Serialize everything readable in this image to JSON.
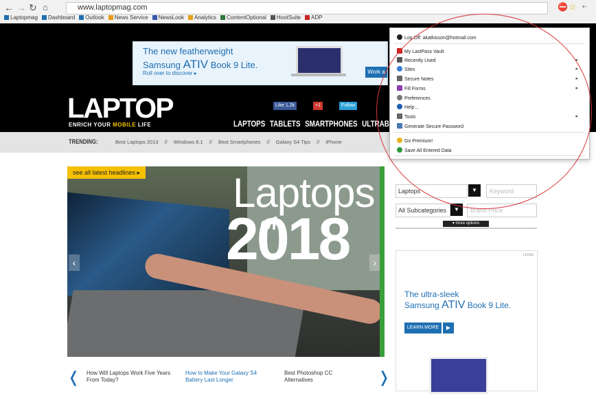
{
  "browser": {
    "url": "www.laptopmag.com",
    "bookmarks": [
      {
        "label": "Laptopmag",
        "color": "#1e6fb2"
      },
      {
        "label": "Dashboard",
        "color": "#1e6fb2"
      },
      {
        "label": "Outlook",
        "color": "#1e6fb2"
      },
      {
        "label": "News Service",
        "color": "#e89a1a"
      },
      {
        "label": "NewsLook",
        "color": "#3355aa"
      },
      {
        "label": "Analytics",
        "color": "#e8a21a"
      },
      {
        "label": "ContentOptional",
        "color": "#2b7a3a"
      },
      {
        "label": "HootSuite",
        "color": "#555"
      },
      {
        "label": "ADP",
        "color": "#cc2222"
      }
    ]
  },
  "ad_top": {
    "line1": "The new featherweight",
    "line2_prefix": "Samsung ",
    "line2_brand": "ATIV",
    "line2_suffix": " Book 9 Lite.",
    "cta": "Roll over to discover ▸",
    "button": "Work a"
  },
  "site": {
    "logo": "LAPTOP",
    "tagline_prefix": "ENRICH YOUR ",
    "tagline_highlight": "MOBILE",
    "tagline_suffix": " LIFE",
    "social": [
      {
        "label": "Like",
        "count": "1.2k",
        "color": "#3b5998"
      },
      {
        "label": "+1",
        "count": "",
        "color": "#cc3732"
      },
      {
        "label": "Follow",
        "count": "",
        "color": "#2a9fd8"
      }
    ],
    "nav": [
      "LAPTOPS",
      "TABLETS",
      "SMARTPHONES",
      "ULTRABOOKS"
    ],
    "trending_label": "TRENDING:",
    "trending": [
      "Best Laptops 2013",
      "//",
      "Windows 8.1",
      "//",
      "Best Smartphones",
      "//",
      "Galaxy S4 Tips",
      "//",
      "iPhone"
    ]
  },
  "hero": {
    "latest_link": "see all latest headlines ▸",
    "title_word": "Laptops",
    "of_word": "of",
    "year": "2018",
    "prev": "‹",
    "next": "›"
  },
  "headlines": [
    {
      "text": "How Will Laptops Work Five Years From Today?",
      "active": false
    },
    {
      "text": "How to Make Your Galaxy S4 Battery Last Longer",
      "active": true
    },
    {
      "text": "Best Photoshop CC Alternatives",
      "active": false
    }
  ],
  "search": {
    "category": "Laptops",
    "keyword_placeholder": "Keyword",
    "subcategory": "All Subcategories",
    "brand_placeholder": "Brand Price",
    "more_options": "▾ more options"
  },
  "ad_right": {
    "legal": "LEGAL",
    "line1": "The ultra-sleek",
    "line2_prefix": "Samsung ",
    "line2_brand": "ATIV",
    "line2_suffix": " Book 9 Lite.",
    "learn_more": "LEARN MORE",
    "play": "▶"
  },
  "lastpass_menu": {
    "items": [
      {
        "label": "Log Off: akatkisson@hotmail.com",
        "icon": "power-icon",
        "color": "#222",
        "submenu": false
      },
      {
        "label": "My LastPass Vault",
        "icon": "vault-icon",
        "color": "#cc2222",
        "submenu": false
      },
      {
        "label": "Recently Used",
        "icon": "clock-icon",
        "color": "#555",
        "submenu": true
      },
      {
        "label": "Sites",
        "icon": "globe-icon",
        "color": "#3b7fd0",
        "submenu": true
      },
      {
        "label": "Secure Notes",
        "icon": "note-icon",
        "color": "#666",
        "submenu": true
      },
      {
        "label": "Fill Forms",
        "icon": "form-icon",
        "color": "#8a3fb0",
        "submenu": true
      },
      {
        "label": "Preferences",
        "icon": "gear-icon",
        "color": "#777",
        "submenu": false
      },
      {
        "label": "Help...",
        "icon": "help-icon",
        "color": "#1e5fb0",
        "submenu": false
      },
      {
        "label": "Tools",
        "icon": "tools-icon",
        "color": "#666",
        "submenu": true
      },
      {
        "label": "Generate Secure Password",
        "icon": "password-icon",
        "color": "#4a7ab0",
        "submenu": false
      },
      {
        "label": "Go Premium!",
        "icon": "star-icon",
        "color": "#e8b21a",
        "submenu": false
      },
      {
        "label": "Save All Entered Data",
        "icon": "plus-icon",
        "color": "#2a9a3a",
        "submenu": false
      }
    ]
  },
  "colors": {
    "accent": "#1e6fb2",
    "highlight": "#f5c000",
    "annotation": "#d9363a"
  }
}
